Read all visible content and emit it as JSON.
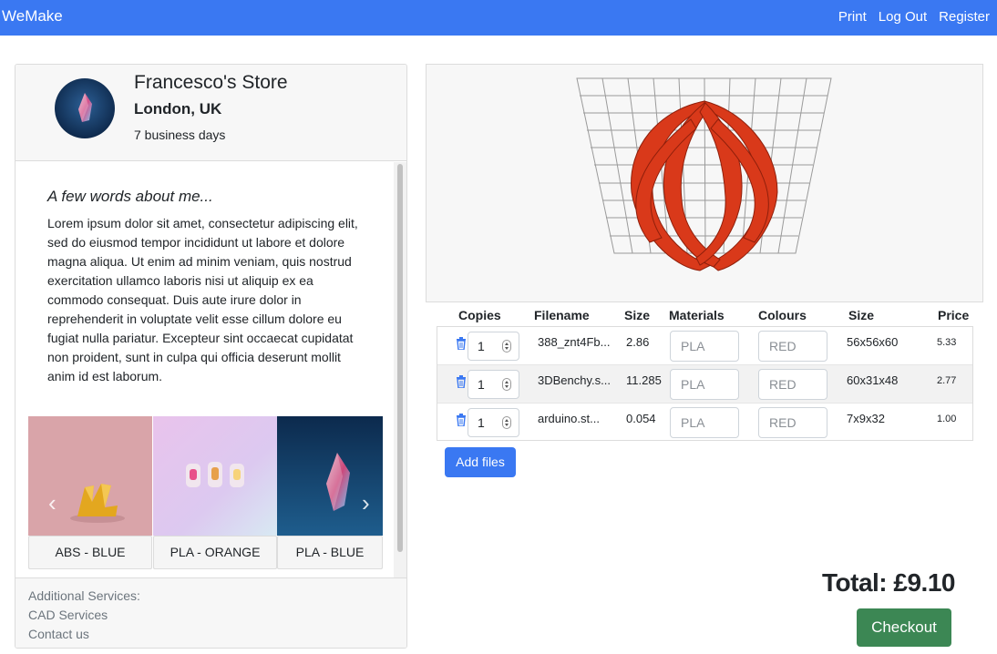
{
  "nav": {
    "brand": "WeMake",
    "links": [
      "Print",
      "Log Out",
      "Register"
    ]
  },
  "store": {
    "name": "Francesco's Store",
    "location": "London, UK",
    "delivery": "7 business days",
    "about_title": "A few words about me...",
    "about_text": "Lorem ipsum dolor sit amet, consectetur adipiscing elit, sed do eiusmod tempor incididunt ut labore et dolore magna aliqua. Ut enim ad minim veniam, quis nostrud exercitation ullamco laboris nisi ut aliquip ex ea commodo consequat. Duis aute irure dolor in reprehenderit in voluptate velit esse cillum dolore eu fugiat nulla pariatur. Excepteur sint occaecat cupidatat non proident, sunt in culpa qui officia deserunt mollit anim id est laborum.",
    "samples": [
      {
        "label": "ABS - BLUE"
      },
      {
        "label": "PLA - ORANGE"
      },
      {
        "label": "PLA - BLUE"
      }
    ],
    "footer": {
      "heading": "Additional Services:",
      "links": [
        "CAD Services",
        "Contact us"
      ]
    }
  },
  "table": {
    "headers": [
      "Copies",
      "Filename",
      "Size",
      "Materials",
      "Colours",
      "Size",
      "Price"
    ],
    "rows": [
      {
        "copies": "1",
        "filename": "388_znt4Fb...",
        "size": "2.86",
        "material": "PLA",
        "colour": "RED",
        "dimensions": "56x56x60",
        "price": "5.33"
      },
      {
        "copies": "1",
        "filename": "3DBenchy.s...",
        "size": "11.285",
        "material": "PLA",
        "colour": "RED",
        "dimensions": "60x31x48",
        "price": "2.77"
      },
      {
        "copies": "1",
        "filename": "arduino.st...",
        "size": "0.054",
        "material": "PLA",
        "colour": "RED",
        "dimensions": "7x9x32",
        "price": "1.00"
      }
    ]
  },
  "actions": {
    "add_files": "Add files",
    "total": "Total: £9.10",
    "checkout": "Checkout"
  },
  "colors": {
    "primary": "#3a78f2",
    "success": "#3c8754",
    "model": "#d9391a"
  }
}
